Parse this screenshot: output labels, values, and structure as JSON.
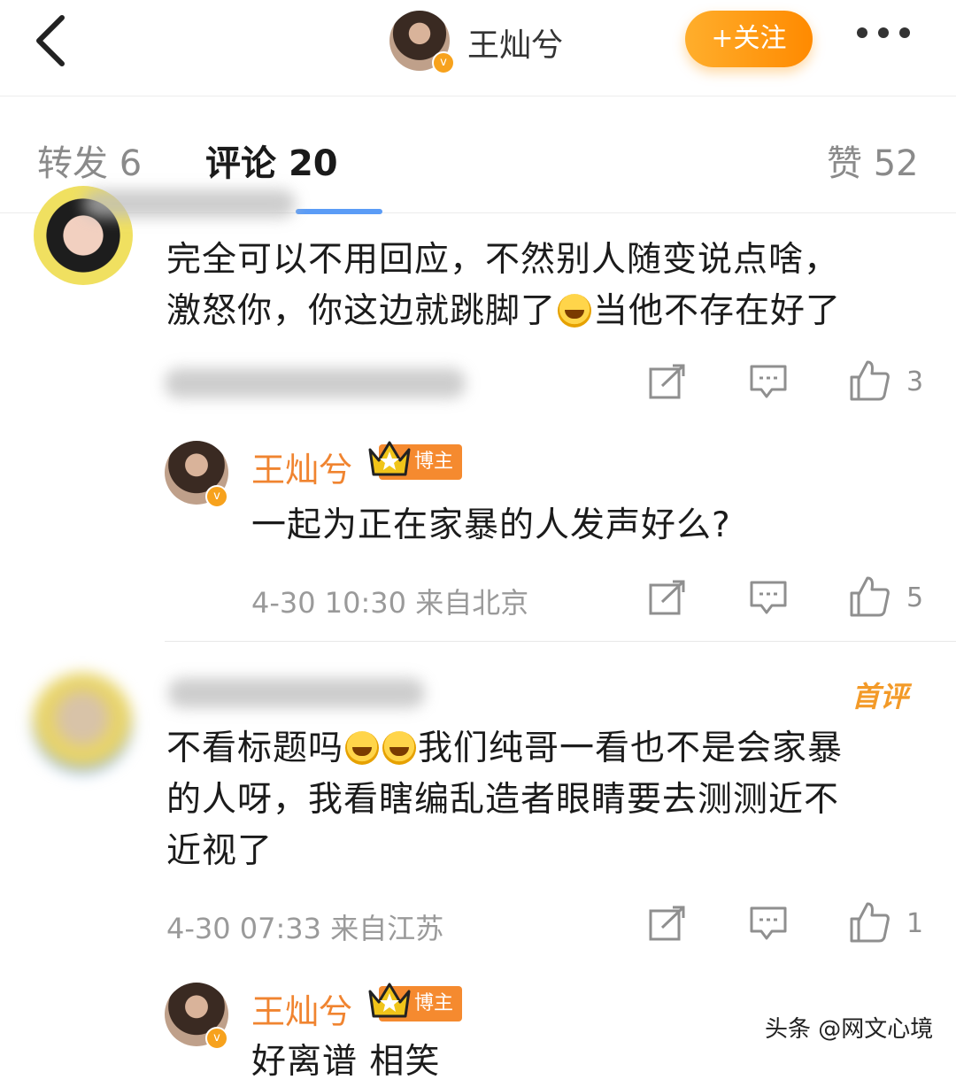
{
  "header": {
    "user_name": "王灿兮",
    "follow_label": "+关注",
    "verified_icon": "verified-v-icon"
  },
  "tabs": [
    {
      "label": "转发",
      "count": "6"
    },
    {
      "label": "评论",
      "count": "20"
    },
    {
      "label": "赞",
      "count": "52"
    }
  ],
  "comments": [
    {
      "text_line1": "完全可以不用回应，不然别人随变说点啥，",
      "text_line2_a": "激怒你，你这边就跳脚了",
      "text_line2_b": "当他不存在好了",
      "like_count": "3"
    },
    {
      "reply_user": "王灿兮",
      "badge": "博主",
      "text": "一起为正在家暴的人发声好么?",
      "time": "4-30 10:30",
      "location": "来自北京",
      "like_count": "5"
    },
    {
      "tag": "首评",
      "text_line1_a": "不看标题吗",
      "text_line1_b": "我们纯哥一看也不是会家暴",
      "text_line2": "的人呀，我看瞎编乱造者眼睛要去测测近不",
      "text_line3": "近视了",
      "time": "4-30 07:33",
      "location": "来自江苏",
      "like_count": "1"
    },
    {
      "reply_user": "王灿兮",
      "badge": "博主",
      "text_partial": "好离谱 相笑"
    }
  ],
  "watermark": "头条 @网文心境",
  "colors": {
    "accent_orange": "#ff9a1a",
    "reply_name": "#f08430",
    "tab_underline": "#5b9cf6"
  }
}
